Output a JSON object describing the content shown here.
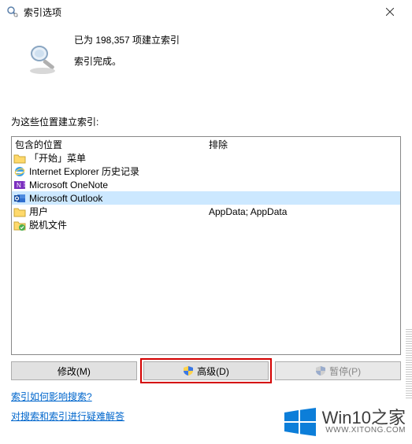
{
  "titlebar": {
    "title": "索引选项"
  },
  "status": {
    "line1": "已为 198,357 项建立索引",
    "line2": "索引完成。"
  },
  "section": {
    "label": "为这些位置建立索引:"
  },
  "list": {
    "header": {
      "col1": "包含的位置",
      "col2": "排除"
    },
    "rows": [
      {
        "icon": "folder",
        "name": "「开始」菜单",
        "exclude": ""
      },
      {
        "icon": "ie",
        "name": "Internet Explorer 历史记录",
        "exclude": ""
      },
      {
        "icon": "onenote",
        "name": "Microsoft OneNote",
        "exclude": ""
      },
      {
        "icon": "outlook",
        "name": "Microsoft Outlook",
        "exclude": "",
        "selected": true
      },
      {
        "icon": "folder",
        "name": "用户",
        "exclude": "AppData; AppData"
      },
      {
        "icon": "offline",
        "name": "脱机文件",
        "exclude": ""
      }
    ]
  },
  "buttons": {
    "modify": "修改(M)",
    "advanced": "高级(D)",
    "pause": "暂停(P)"
  },
  "links": {
    "l1": "索引如何影响搜索?",
    "l2": "对搜索和索引进行疑难解答"
  },
  "watermark": {
    "big": "Win10之家",
    "small": "WWW.XITONG.COM"
  }
}
